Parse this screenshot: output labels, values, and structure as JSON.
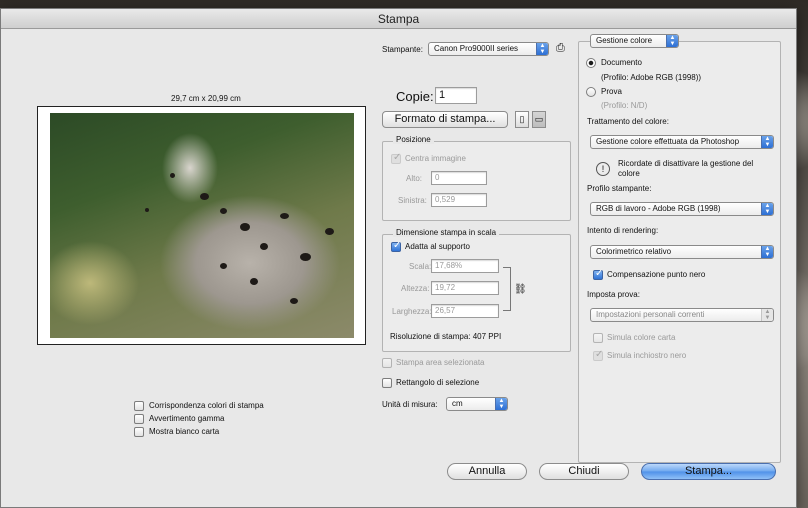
{
  "window": {
    "title": "Stampa"
  },
  "printer": {
    "label": "Stampante:",
    "value": "Canon Pro9000II series"
  },
  "copies": {
    "label": "Copie:",
    "value": "1"
  },
  "page_setup_button": "Formato di stampa...",
  "preview": {
    "paper_size": "29,7 cm x 20,99 cm"
  },
  "position": {
    "title": "Posizione",
    "center_image_label": "Centra immagine",
    "top_label": "Alto:",
    "top_value": "0",
    "left_label": "Sinistra:",
    "left_value": "0,529"
  },
  "scaled_size": {
    "title": "Dimensione stampa in scala",
    "fit_media_label": "Adatta al supporto",
    "scale_label": "Scala:",
    "scale_value": "17,68%",
    "height_label": "Altezza:",
    "height_value": "19,72",
    "width_label": "Larghezza:",
    "width_value": "26,57",
    "resolution": "Risoluzione di stampa: 407 PPI"
  },
  "print_selected_area_label": "Stampa area selezionata",
  "bounding_box_label": "Rettangolo di selezione",
  "units": {
    "label": "Unità di misura:",
    "value": "cm"
  },
  "left_options": {
    "match_print_colors": "Corrispondenza colori di stampa",
    "gamut_warning": "Avvertimento gamma",
    "show_paper_white": "Mostra bianco carta"
  },
  "color_panel": {
    "section_popup": "Gestione colore",
    "document_label": "Documento",
    "document_profile": "(Profilo: Adobe RGB (1998))",
    "proof_label": "Prova",
    "proof_profile": "(Profilo: N/D)",
    "color_handling_label": "Trattamento del colore:",
    "color_handling_value": "Gestione colore effettuata da Photoshop",
    "warning_text": "Ricordate di disattivare la gestione del colore",
    "printer_profile_label": "Profilo stampante:",
    "printer_profile_value": "RGB di lavoro - Adobe RGB (1998)",
    "rendering_intent_label": "Intento di rendering:",
    "rendering_intent_value": "Colorimetrico relativo",
    "black_point_label": "Compensazione punto nero",
    "proof_setup_label": "Imposta prova:",
    "proof_setup_value": "Impostazioni personali correnti",
    "simulate_paper_color": "Simula colore carta",
    "simulate_black_ink": "Simula inchiostro nero"
  },
  "buttons": {
    "cancel": "Annulla",
    "close": "Chiudi",
    "print": "Stampa..."
  },
  "colors": {
    "accent": "#4e90e8",
    "window_bg": "#e8e8e8"
  }
}
